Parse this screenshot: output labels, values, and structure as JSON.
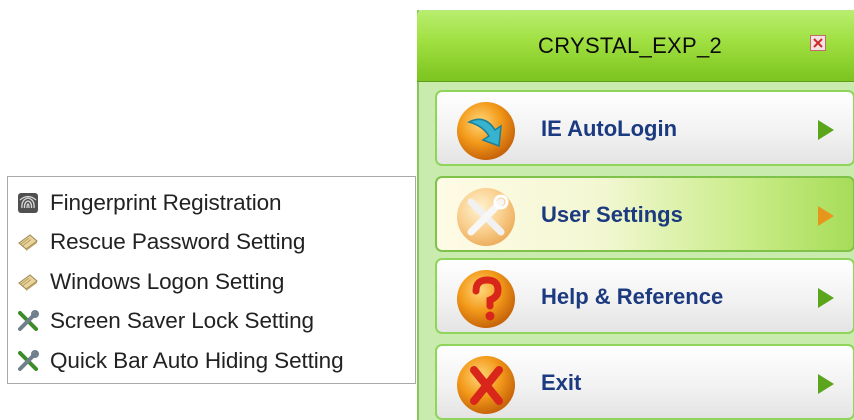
{
  "submenu": {
    "items": [
      {
        "label": "Fingerprint Registration",
        "icon": "fingerprint-icon"
      },
      {
        "label": "Rescue Password Setting",
        "icon": "card-icon"
      },
      {
        "label": "Windows Logon Setting",
        "icon": "card-icon"
      },
      {
        "label": "Screen Saver Lock Setting",
        "icon": "tools-icon"
      },
      {
        "label": "Quick Bar Auto Hiding Setting",
        "icon": "tools-icon"
      }
    ]
  },
  "panel": {
    "title": "CRYSTAL_EXP_2",
    "close_icon": "close-icon",
    "items": [
      {
        "label": "IE AutoLogin",
        "icon": "download-arrow-icon"
      },
      {
        "label": "User Settings",
        "icon": "tools-icon",
        "selected": true
      },
      {
        "label": "Help & Reference",
        "icon": "question-icon"
      },
      {
        "label": "Exit",
        "icon": "x-icon"
      }
    ]
  },
  "colors": {
    "title_green": "#9fdf40",
    "item_border": "#8fd45b",
    "label_blue": "#1c3a80",
    "arrow_green": "#5aa51c",
    "arrow_orange": "#e8951c"
  }
}
